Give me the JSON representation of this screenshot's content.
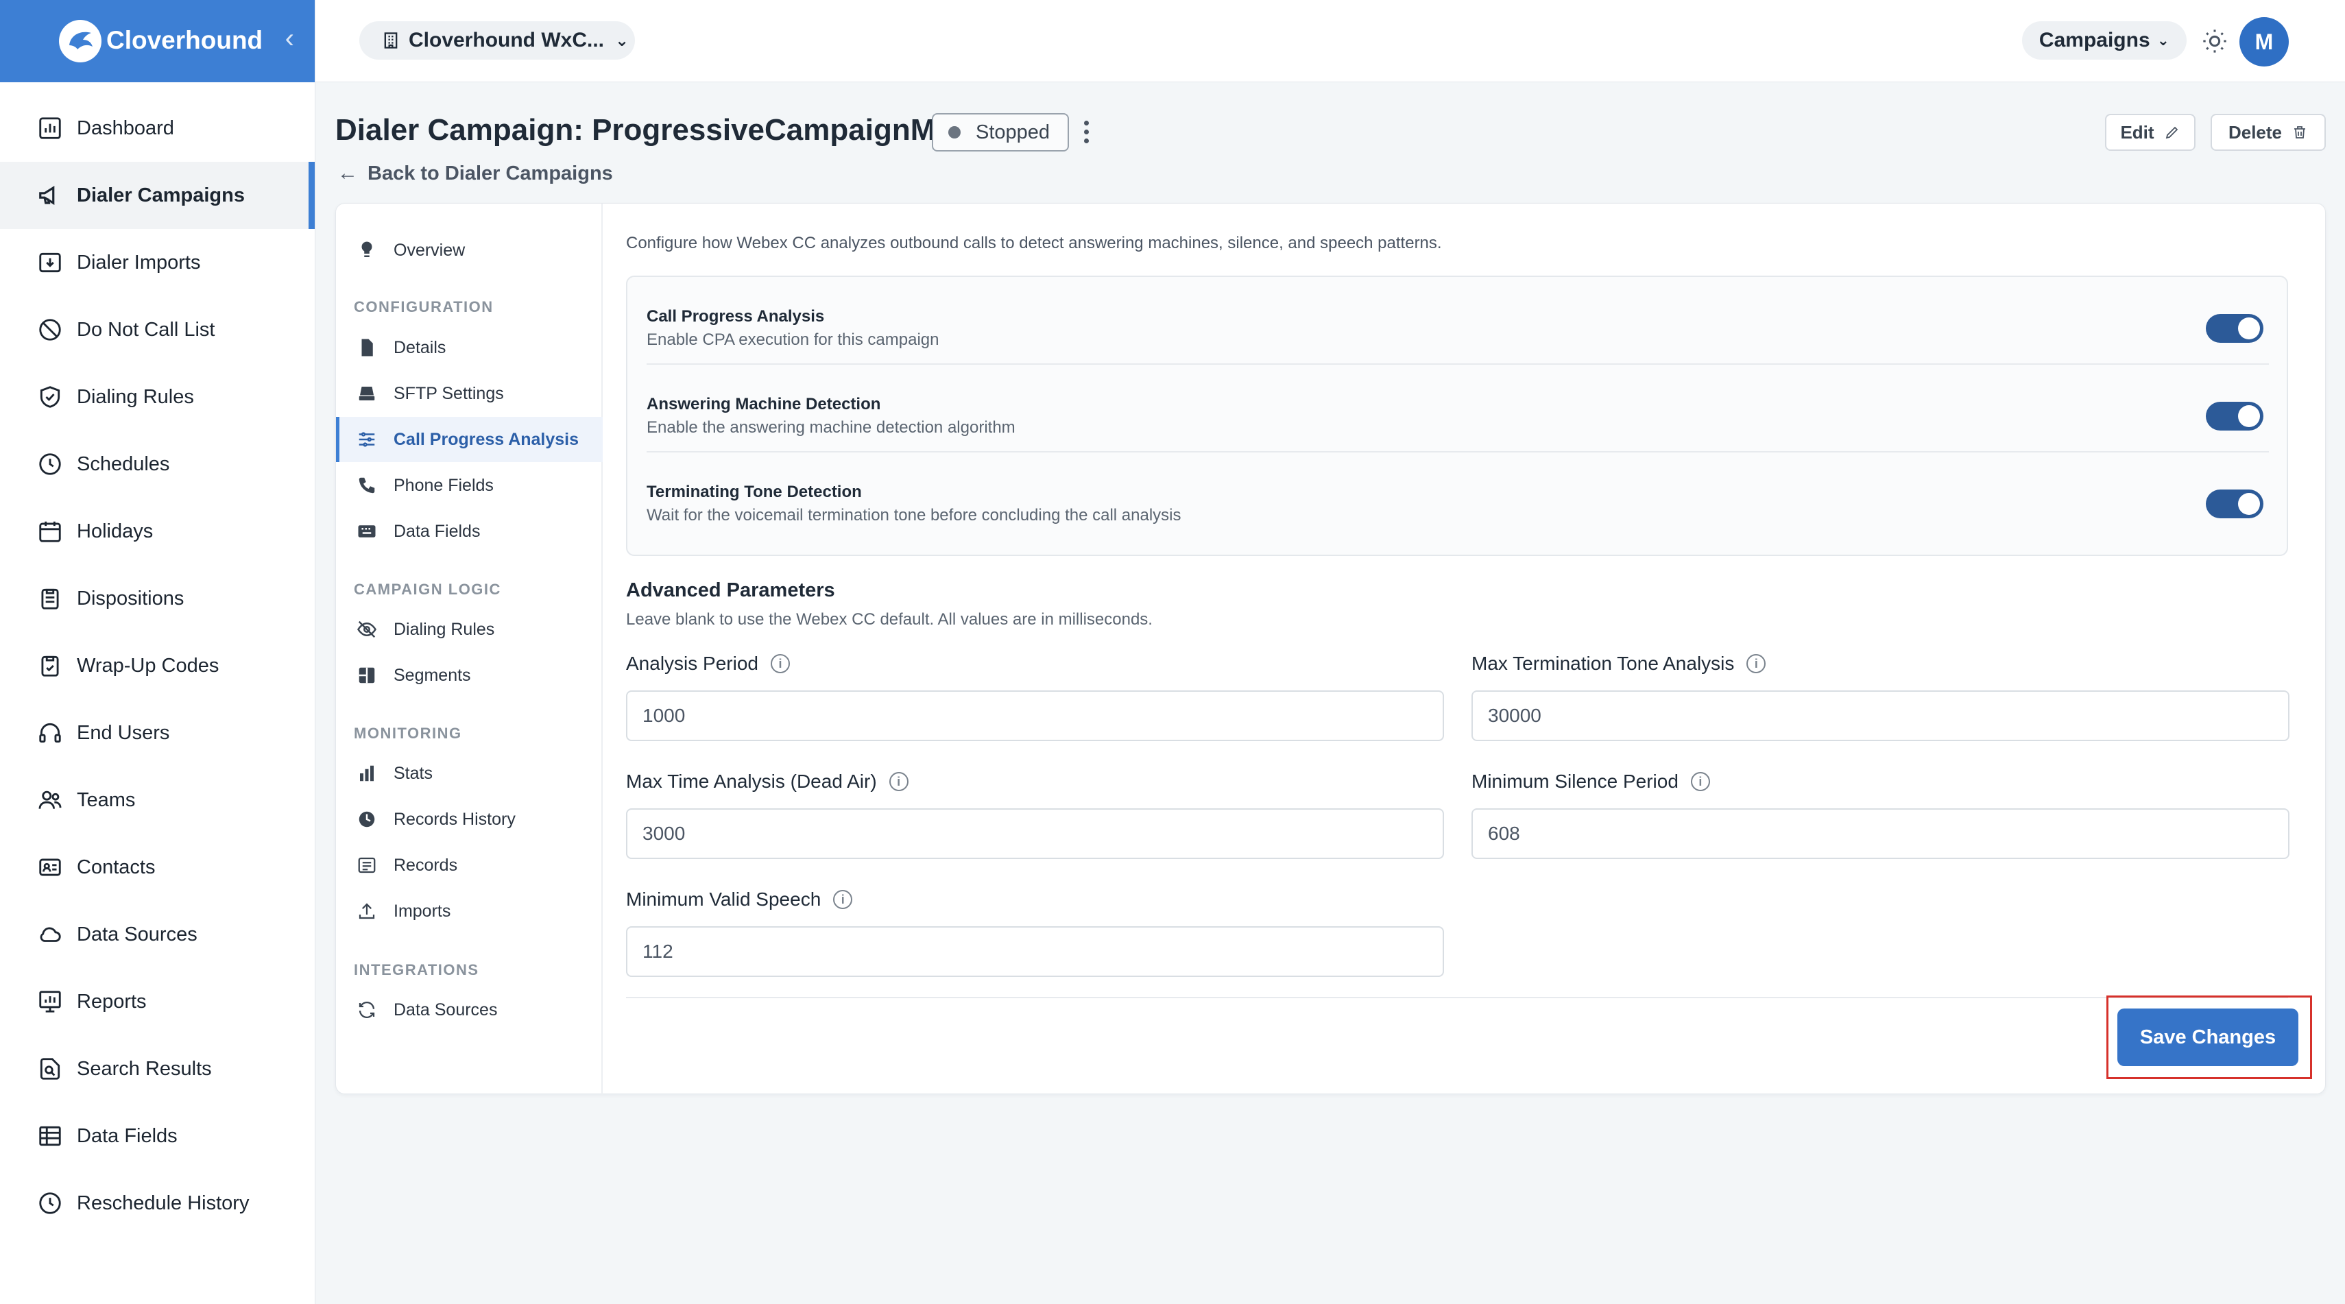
{
  "brand": {
    "name": "Cloverhound",
    "collapse_icon": "chevron-left-icon"
  },
  "sidebar": {
    "items": [
      {
        "label": "Dashboard",
        "icon": "chart-icon"
      },
      {
        "label": "Dialer Campaigns",
        "icon": "megaphone-icon",
        "active": true
      },
      {
        "label": "Dialer Imports",
        "icon": "import-icon"
      },
      {
        "label": "Do Not Call List",
        "icon": "ban-icon"
      },
      {
        "label": "Dialing Rules",
        "icon": "shield-check-icon"
      },
      {
        "label": "Schedules",
        "icon": "clock-icon"
      },
      {
        "label": "Holidays",
        "icon": "calendar-icon"
      },
      {
        "label": "Dispositions",
        "icon": "clipboard-icon"
      },
      {
        "label": "Wrap-Up Codes",
        "icon": "clipboard-check-icon"
      },
      {
        "label": "End Users",
        "icon": "headset-icon"
      },
      {
        "label": "Teams",
        "icon": "users-icon"
      },
      {
        "label": "Contacts",
        "icon": "contact-card-icon"
      },
      {
        "label": "Data Sources",
        "icon": "cloud-icon"
      },
      {
        "label": "Reports",
        "icon": "report-icon"
      },
      {
        "label": "Search Results",
        "icon": "search-doc-icon"
      },
      {
        "label": "Data Fields",
        "icon": "table-icon"
      },
      {
        "label": "Reschedule History",
        "icon": "history-clock-icon"
      }
    ]
  },
  "topbar": {
    "org_select": "Cloverhound WxC...",
    "campaign_select": "Campaigns",
    "avatar_initial": "M"
  },
  "header": {
    "title": "Dialer Campaign: ProgressiveCampaignM",
    "status": "Stopped",
    "back_link": "Back to Dialer Campaigns",
    "edit_label": "Edit",
    "delete_label": "Delete"
  },
  "subnav": {
    "overview": "Overview",
    "sections": {
      "configuration": "CONFIGURATION",
      "campaign_logic": "CAMPAIGN LOGIC",
      "monitoring": "MONITORING",
      "integrations": "INTEGRATIONS"
    },
    "items": {
      "details": "Details",
      "sftp": "SFTP Settings",
      "cpa": "Call Progress Analysis",
      "phone_fields": "Phone Fields",
      "data_fields": "Data Fields",
      "dialing_rules": "Dialing Rules",
      "segments": "Segments",
      "stats": "Stats",
      "records_history": "Records History",
      "records": "Records",
      "imports": "Imports",
      "data_sources": "Data Sources"
    }
  },
  "cpa": {
    "intro": "Configure how Webex CC analyzes outbound calls to detect answering machines, silence, and speech patterns.",
    "toggles": [
      {
        "title": "Call Progress Analysis",
        "desc": "Enable CPA execution for this campaign",
        "on": true
      },
      {
        "title": "Answering Machine Detection",
        "desc": "Enable the answering machine detection algorithm",
        "on": true
      },
      {
        "title": "Terminating Tone Detection",
        "desc": "Wait for the voicemail termination tone before concluding the call analysis",
        "on": true
      }
    ],
    "advanced_title": "Advanced Parameters",
    "advanced_desc": "Leave blank to use the Webex CC default. All values are in milliseconds.",
    "fields": {
      "analysis_period": {
        "label": "Analysis Period",
        "value": "1000"
      },
      "max_termination_tone": {
        "label": "Max Termination Tone Analysis",
        "value": "30000"
      },
      "max_time_dead_air": {
        "label": "Max Time Analysis (Dead Air)",
        "value": "3000"
      },
      "min_silence": {
        "label": "Minimum Silence Period",
        "value": "608"
      },
      "min_valid_speech": {
        "label": "Minimum Valid Speech",
        "value": "112"
      }
    },
    "save_label": "Save Changes"
  },
  "colors": {
    "brand": "#3d7fd4",
    "toggle_on": "#2c5a98",
    "save_button": "#3674c8",
    "highlight_box": "#d6312b"
  }
}
